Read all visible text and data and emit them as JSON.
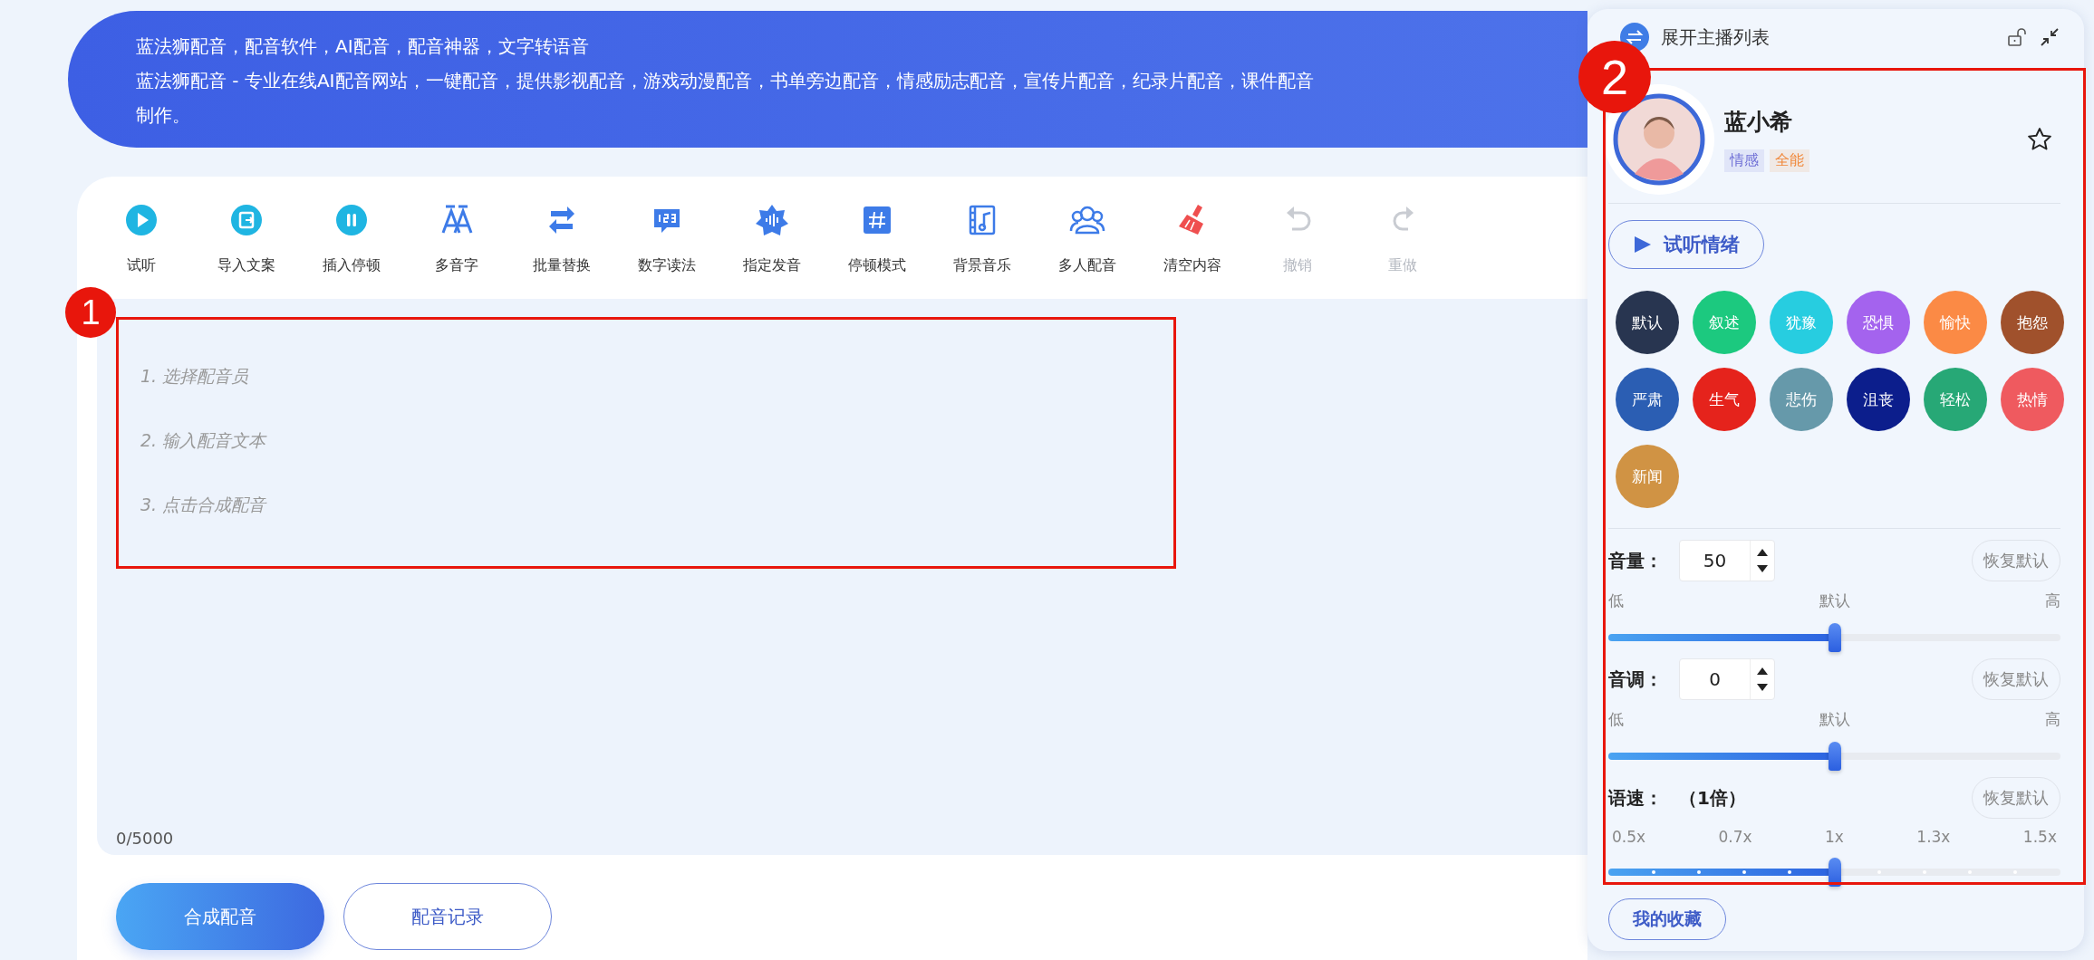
{
  "banner": {
    "title": "蓝法狮配音，配音软件，AI配音，配音神器，文字转语音",
    "description": "蓝法狮配音 - 专业在线AI配音网站，一键配音，提供影视配音，游戏动漫配音，书单旁边配音，情感励志配音，宣传片配音，纪录片配音，课件配音",
    "description_end": "制作。"
  },
  "toolbar": [
    {
      "label": "试听",
      "disabled": false
    },
    {
      "label": "导入文案",
      "disabled": false
    },
    {
      "label": "插入停顿",
      "disabled": false
    },
    {
      "label": "多音字",
      "disabled": false
    },
    {
      "label": "批量替换",
      "disabled": false
    },
    {
      "label": "数字读法",
      "disabled": false
    },
    {
      "label": "指定发音",
      "disabled": false
    },
    {
      "label": "停顿模式",
      "disabled": false
    },
    {
      "label": "背景音乐",
      "disabled": false
    },
    {
      "label": "多人配音",
      "disabled": false
    },
    {
      "label": "清空内容",
      "disabled": false
    },
    {
      "label": "撤销",
      "disabled": true
    },
    {
      "label": "重做",
      "disabled": true
    }
  ],
  "editor": {
    "placeholder": [
      "1. 选择配音员",
      "2. 输入配音文本",
      "3. 点击合成配音"
    ],
    "counter": "0/5000"
  },
  "buttons": [
    {
      "label": "合成配音",
      "kind": "primary"
    },
    {
      "label": "配音记录",
      "kind": "outline"
    }
  ],
  "annotations": [
    {
      "label": "1"
    },
    {
      "label": "2"
    }
  ],
  "panel": {
    "title": "展开主播列表",
    "voice": {
      "name": "蓝小希",
      "favorite": false,
      "tags": [
        {
          "label": "情感",
          "color": "#6f6fd6"
        },
        {
          "label": "全能",
          "color": "#f0883a"
        }
      ]
    },
    "preview_button": "试听情绪",
    "emotions": [
      {
        "label": "默认",
        "color": "#283550"
      },
      {
        "label": "叙述",
        "color": "#1cc97f"
      },
      {
        "label": "犹豫",
        "color": "#27cde0"
      },
      {
        "label": "恐惧",
        "color": "#a463ee"
      },
      {
        "label": "愉快",
        "color": "#fb8a45"
      },
      {
        "label": "抱怨",
        "color": "#a0512c"
      },
      {
        "label": "严肃",
        "color": "#2b5eb3"
      },
      {
        "label": "生气",
        "color": "#e5231c"
      },
      {
        "label": "悲伤",
        "color": "#6699aa"
      },
      {
        "label": "沮丧",
        "color": "#0c1e8c"
      },
      {
        "label": "轻松",
        "color": "#27a876"
      },
      {
        "label": "热情",
        "color": "#ef5a5f"
      },
      {
        "label": "新闻",
        "color": "#d09344"
      }
    ],
    "sliders": [
      {
        "kind": "number",
        "label": "音量：",
        "value": "50",
        "reset": "恢复默认",
        "ticks": [
          "低",
          "默认",
          "高"
        ],
        "level": 0.5
      },
      {
        "kind": "number",
        "label": "音调：",
        "value": "0",
        "reset": "恢复默认",
        "ticks": [
          "低",
          "默认",
          "高"
        ],
        "level": 0.5
      },
      {
        "kind": "steps",
        "label": "语速：",
        "value": "（1倍）",
        "reset": "恢复默认",
        "ticks": [
          "0.5x",
          "0.7x",
          "1x",
          "1.3x",
          "1.5x"
        ],
        "level": 0.5
      }
    ],
    "favorites_button": "我的收藏"
  }
}
